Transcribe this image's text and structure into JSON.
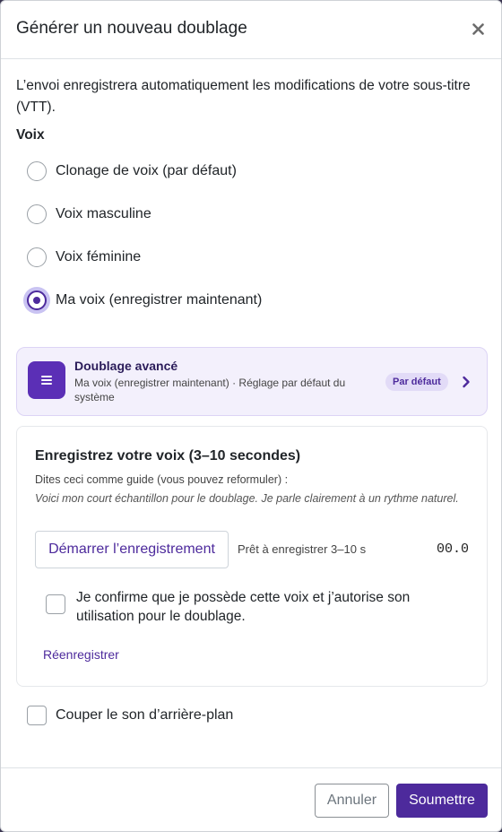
{
  "modal": {
    "title": "Générer un nouveau doublage",
    "close_symbol": "×"
  },
  "intro_text": "L’envoi enregistrera automatiquement les modifications de votre sous-titre (VTT).",
  "voice": {
    "label": "Voix",
    "options": [
      {
        "label": "Clonage de voix (par défaut)",
        "checked": false
      },
      {
        "label": "Voix masculine",
        "checked": false
      },
      {
        "label": "Voix féminine",
        "checked": false
      },
      {
        "label": "Ma voix (enregistrer maintenant)",
        "checked": true
      }
    ]
  },
  "advanced": {
    "title": "Doublage avancé",
    "subtitle": "Ma voix (enregistrer maintenant) · Réglage par défaut du système",
    "badge": "Par défaut",
    "icon": "menu-lines-icon",
    "chevron": "chevron-right-icon"
  },
  "recording": {
    "title": "Enregistrez votre voix (3–10 secondes)",
    "guide": "Dites ceci comme guide (vous pouvez reformuler) :",
    "quote": "Voici mon court échantillon pour le doublage. Je parle clairement à un rythme naturel.",
    "start_button": "Démarrer l’enregistrement",
    "status": "Prêt à enregistrer 3–10 s",
    "timer": "00.0",
    "confirm_label": "Je confirme que je possède cette voix et j’autorise son utilisation pour le doublage.",
    "confirm_checked": false,
    "rerecord_link": "Réenregistrer"
  },
  "mute_background": {
    "label": "Couper le son d’arrière-plan",
    "checked": false
  },
  "footer": {
    "cancel": "Annuler",
    "submit": "Soumettre"
  },
  "colors": {
    "accent": "#4d2a9c",
    "accent_light": "#f3f0fc",
    "badge_bg": "#e2dbf7"
  }
}
